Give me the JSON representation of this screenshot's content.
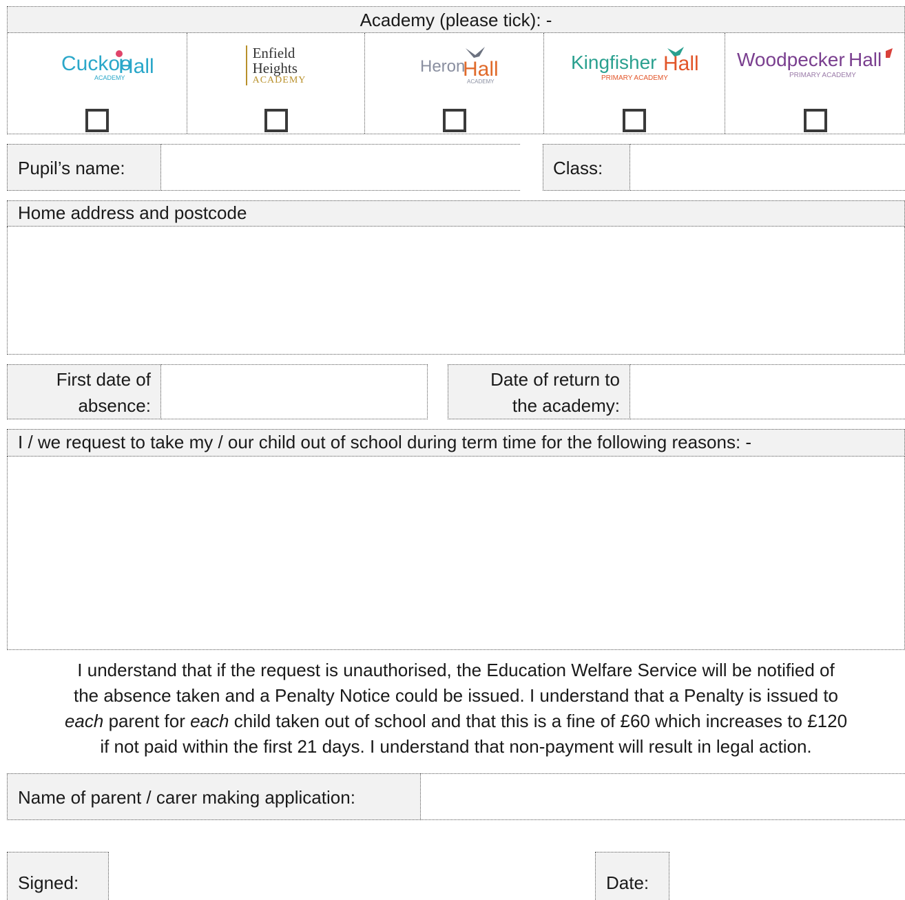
{
  "academy": {
    "heading": "Academy (please tick): -",
    "options": [
      {
        "logo_text": "Cuckoo",
        "logo_text2": "Hall",
        "logo_sub": "ACADEMY",
        "color": "#2aa7c9",
        "accent": "#e0456a"
      },
      {
        "logo_line1": "Enfield",
        "logo_line2": "Heights",
        "logo_line3": "ACADEMY",
        "color": "#333333",
        "accent": "#b8902a"
      },
      {
        "logo_text": "Heron",
        "logo_text2": "Hall",
        "logo_sub": "ACADEMY",
        "color": "#8a8fa0",
        "accent": "#e06a2a"
      },
      {
        "logo_text": "Kingfisher",
        "logo_text2": "Hall",
        "logo_sub": "PRIMARY ACADEMY",
        "color": "#2aa08f",
        "accent": "#e2562a"
      },
      {
        "logo_text": "Woodpecker",
        "logo_text2": "Hall",
        "logo_sub": "PRIMARY ACADEMY",
        "color": "#7a3f8f",
        "accent": "#d9403a"
      }
    ]
  },
  "fields": {
    "pupil_name": "Pupil’s name:",
    "class": "Class:",
    "home_address": "Home address and postcode",
    "first_date_1": "First date of",
    "first_date_2": "absence:",
    "return_date_1": "Date of return to",
    "return_date_2": "the academy:",
    "reasons": "I / we request to take my / our child out of school during term time for the following reasons: -",
    "parent_name": "Name of parent / carer making application:",
    "signed": "Signed:",
    "date": "Date:"
  },
  "statement": {
    "line1": "I understand that if the request is unauthorised, the Education Welfare Service will be notified of",
    "line2": "the absence taken and a Penalty Notice could be issued.  I understand that a Penalty is issued to",
    "line3_em1": "each",
    "line3_a": " parent for ",
    "line3_em2": "each",
    "line3_b": " child taken out of school and that this is a fine of £60 which increases to £120",
    "line4": "if not paid within the first 21 days.  I understand that non-payment will result in legal action."
  }
}
